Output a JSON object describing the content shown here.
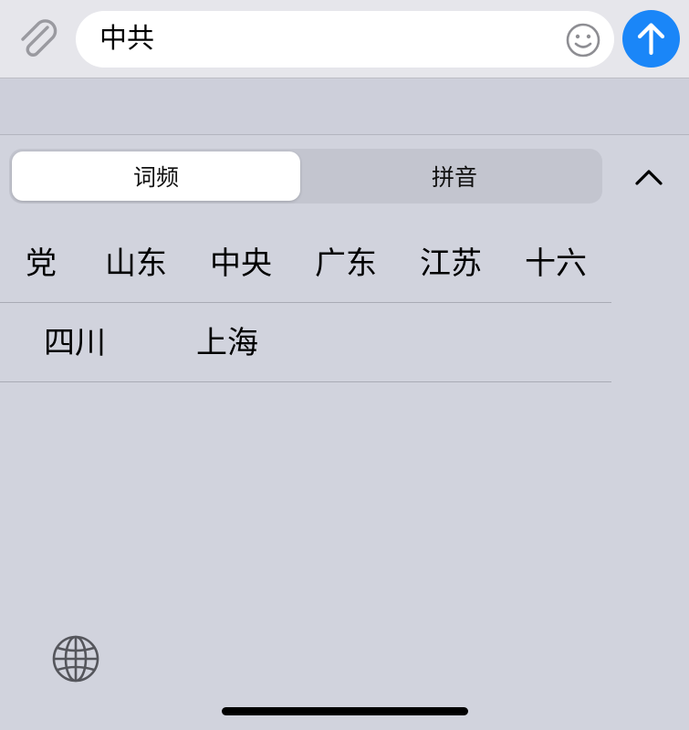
{
  "composer": {
    "input_value": "中共",
    "icons": {
      "attach": "paperclip-icon",
      "emoji": "smiley-icon",
      "send": "arrow-up-icon"
    },
    "send_color": "#1a86f8"
  },
  "keyboard": {
    "tabs": [
      {
        "label": "词频",
        "selected": true
      },
      {
        "label": "拼音",
        "selected": false
      }
    ],
    "collapse_icon": "chevron-up-icon",
    "candidates_row1": [
      "党",
      "山东",
      "中央",
      "广东",
      "江苏",
      "十六"
    ],
    "candidates_row2": [
      "四川",
      "上海"
    ],
    "globe_icon": "globe-icon"
  }
}
